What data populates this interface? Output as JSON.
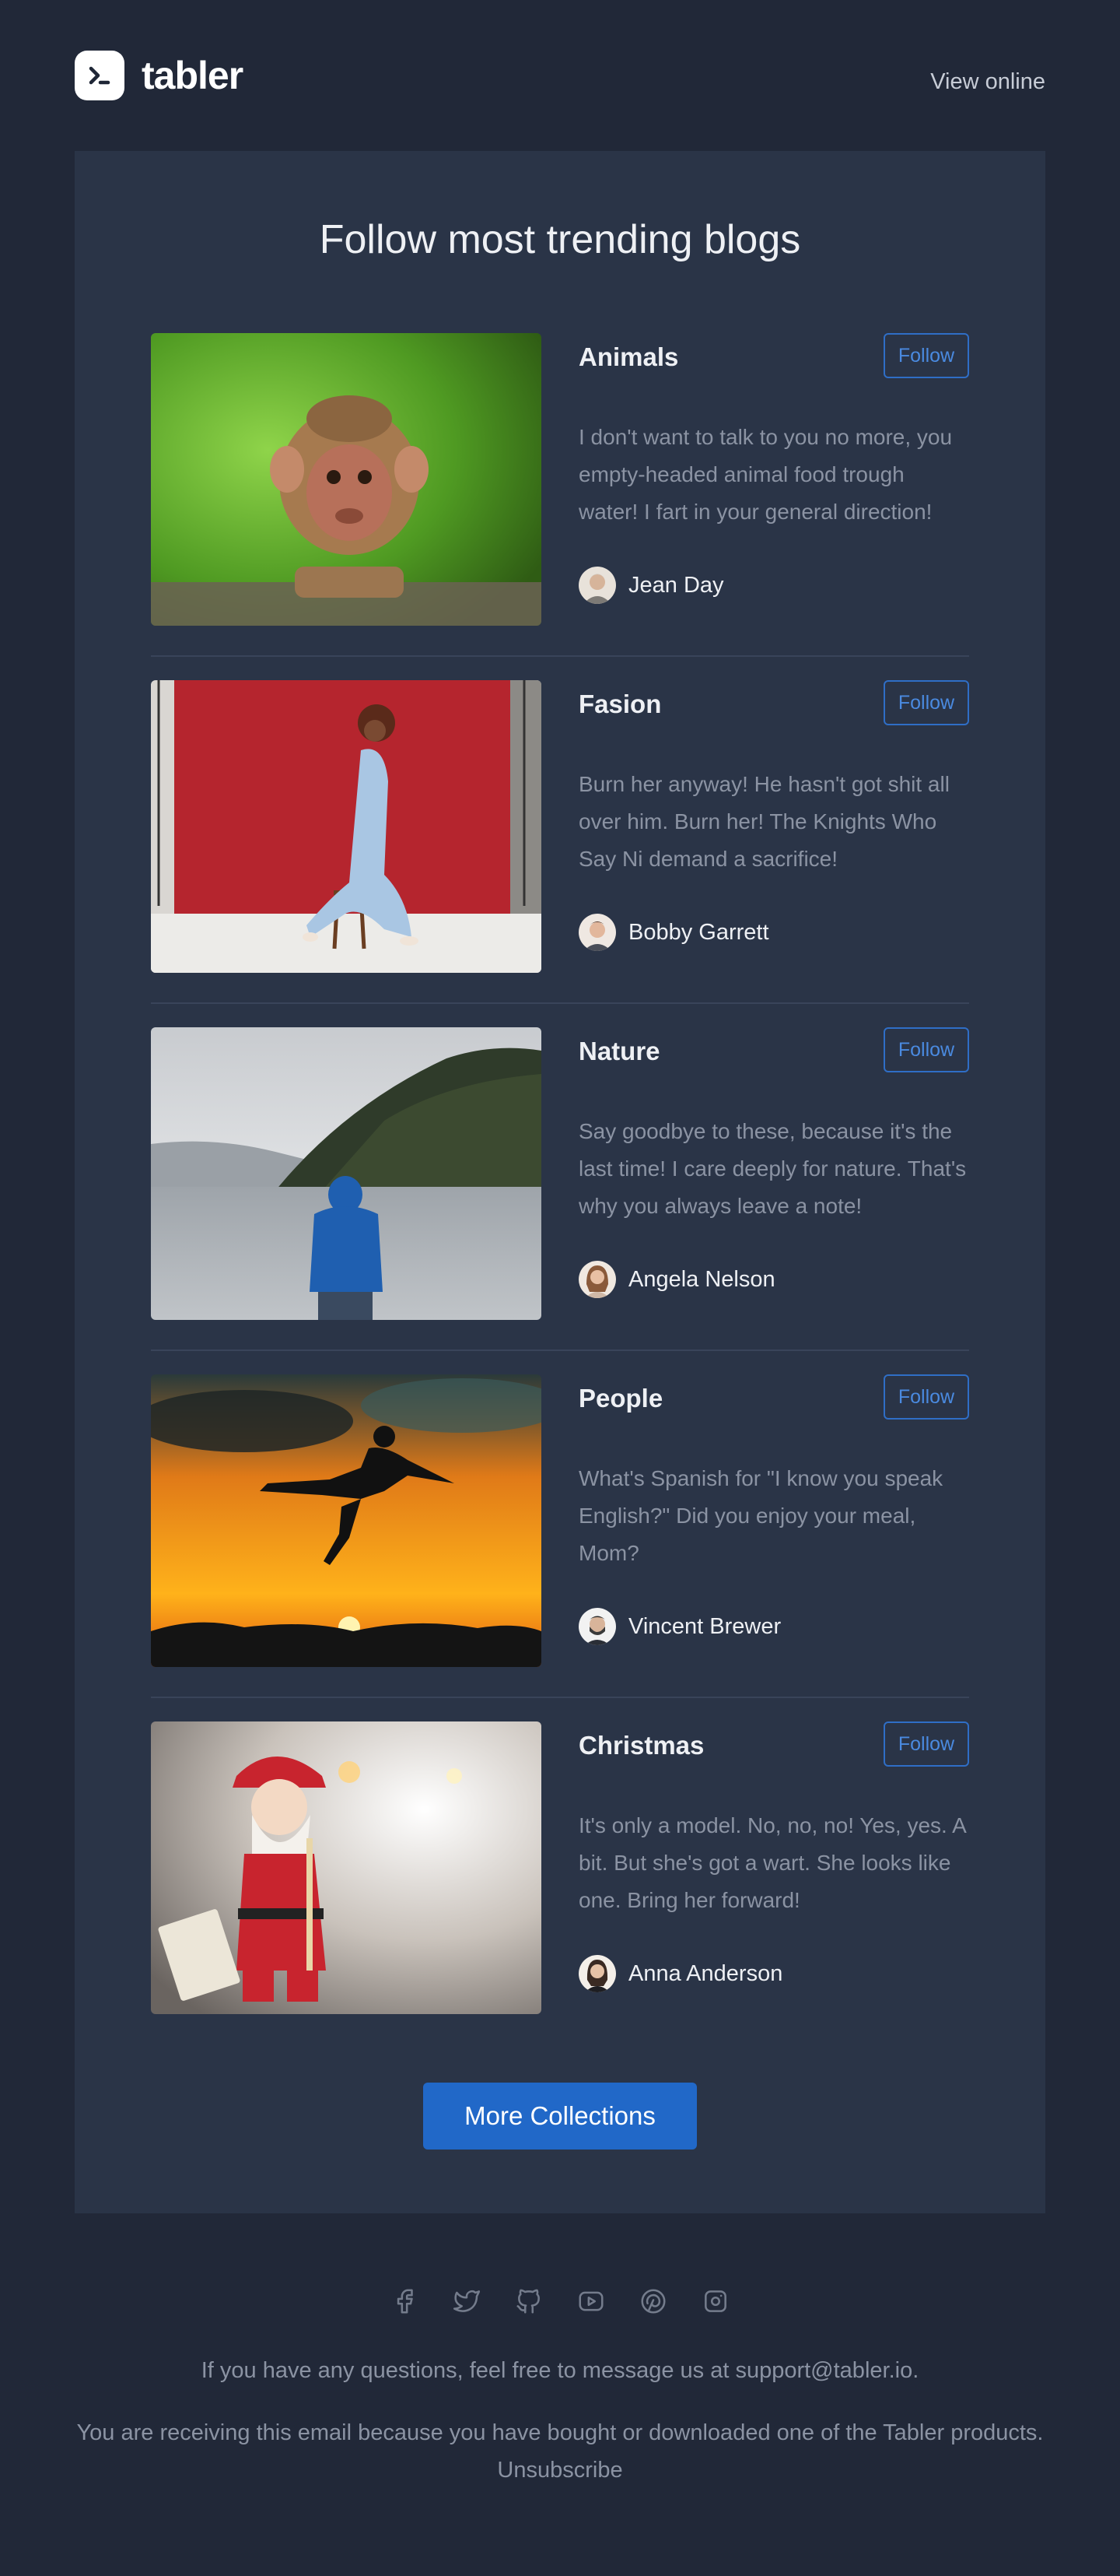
{
  "header": {
    "brand_name": "tabler",
    "view_online_label": "View online"
  },
  "main": {
    "title": "Follow most trending blogs",
    "blogs": [
      {
        "name": "Animals",
        "follow_label": "Follow",
        "description": "I don't want to talk to you no more, you empty-headed animal food trough water! I fart in your general direction!",
        "author": "Jean Day"
      },
      {
        "name": "Fasion",
        "follow_label": "Follow",
        "description": "Burn her anyway! He hasn't got shit all over him. Burn her! The Knights Who Say Ni demand a sacrifice!",
        "author": "Bobby Garrett"
      },
      {
        "name": "Nature",
        "follow_label": "Follow",
        "description": "Say goodbye to these, because it's the last time! I care deeply for nature. That's why you always leave a note!",
        "author": "Angela Nelson"
      },
      {
        "name": "People",
        "follow_label": "Follow",
        "description": "What's Spanish for \"I know you speak English?\" Did you enjoy your meal, Mom?",
        "author": "Vincent Brewer"
      },
      {
        "name": "Christmas",
        "follow_label": "Follow",
        "description": "It's only a model. No, no, no! Yes, yes. A bit. But she's got a wart. She looks like one. Bring her forward!",
        "author": "Anna Anderson"
      }
    ],
    "more_label": "More Collections"
  },
  "footer": {
    "social_icons": [
      "facebook-icon",
      "twitter-icon",
      "github-icon",
      "youtube-icon",
      "pinterest-icon",
      "instagram-icon"
    ],
    "questions_text": "If you have any questions, feel free to message us at support@tabler.io.",
    "receiving_text": "You are receiving this email because you have bought or downloaded one of the Tabler products.",
    "unsubscribe_label": "Unsubscribe"
  },
  "colors": {
    "background": "#212838",
    "card": "#2a3447",
    "accent": "#2168c8",
    "muted_text": "#8b93a3"
  }
}
